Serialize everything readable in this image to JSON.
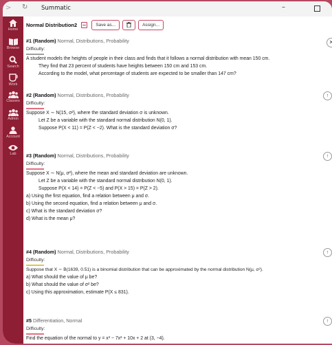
{
  "window": {
    "title": "Summatic"
  },
  "sidebar": {
    "items": [
      {
        "label": "Home",
        "icon": "home-icon"
      },
      {
        "label": "Browse",
        "icon": "book-icon"
      },
      {
        "label": "Search",
        "icon": "search-icon"
      },
      {
        "label": "Work",
        "icon": "cup-icon"
      },
      {
        "label": "Classes",
        "icon": "users-icon"
      },
      {
        "label": "Admin",
        "icon": "admin-users-icon"
      },
      {
        "label": "Account",
        "icon": "person-icon"
      },
      {
        "label": "Lab",
        "icon": "eye-icon"
      }
    ]
  },
  "toolbar": {
    "title": "Normal Distribution2",
    "save_as_label": "Save as...",
    "assign_label": "Assign..."
  },
  "questions": [
    {
      "num": "#1 (Random)",
      "tags": "Normal, Distributions, Probability",
      "difficulty": "Difficulty:",
      "diff_color": "#9e9e9e",
      "lines": [
        "A student models the heights of people in their class and finds that it follows a normal distribution with mean 150 cm.",
        "They find that 23 percent of students have heights between 150 cm and 153 cm.",
        "According to the model, what percentage of students are expected to be smaller than 147 cm?"
      ]
    },
    {
      "num": "#2 (Random)",
      "tags": "Normal, Distributions, Probability",
      "difficulty": "Difficulty:",
      "diff_color": "#e0707f",
      "lines": [
        "Suppose X ∼ N(15, σ²), where the standard deviation σ is unknown.",
        "Let Z be a variable with the standard normal distribution N(0, 1).",
        "Suppose P(X < 11) = P(Z < −2). What is the standard deviation σ?"
      ]
    },
    {
      "num": "#3 (Random)",
      "tags": "Normal, Distributions, Probability",
      "difficulty": "Difficulty:",
      "diff_color": "#e0707f",
      "lines": [
        "Suppose X ∼ N(μ, σ²), where the mean and standard deviation are unknown.",
        "Let Z be a variable with the standard normal distribution N(0, 1).",
        "Suppose P(X < 14) = P(Z < −5) and P(X > 15) = P(Z > 2).",
        "a) Using the first equation, find a relation between μ and σ.",
        "b) Using the second equation, find a relation between μ and σ.",
        "c) What is the standard deviation σ?",
        "d) What is the mean μ?"
      ]
    },
    {
      "num": "#4 (Random)",
      "tags": "Normal, Distributions, Probability",
      "difficulty": "Difficulty:",
      "diff_color": "#e3c34a",
      "lines": [
        "Suppose that X ∼ B(1639, 0.51) is a binomial distribution that can be approximated by the normal distribution N(μ, σ²).",
        "a) What should the value of μ be?",
        "b) What should the value of σ² be?",
        "c) Using this approximation, estimate P(X ≤ 831)."
      ]
    },
    {
      "num": "#5",
      "tags": "Differentiation, Normal",
      "difficulty": "Difficulty:",
      "diff_color": "#e0707f",
      "lines": [
        "Find the equation of the normal to y = x³ − 7x² + 10x + 2 at (3, −4)."
      ]
    }
  ]
}
